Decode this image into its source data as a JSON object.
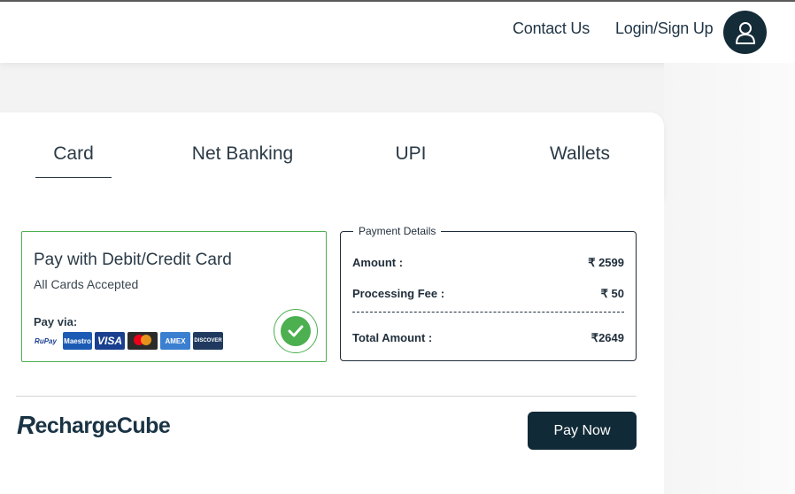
{
  "header": {
    "contact_label": "Contact Us",
    "login_label": "Login/Sign Up",
    "avatar_icon": "user-icon"
  },
  "tabs": [
    {
      "label": "Card",
      "active": true
    },
    {
      "label": "Net Banking",
      "active": false
    },
    {
      "label": "UPI",
      "active": false
    },
    {
      "label": "Wallets",
      "active": false
    }
  ],
  "card_option": {
    "title": "Pay with Debit/Credit Card",
    "subtitle": "All Cards Accepted",
    "pay_via_label": "Pay via:",
    "selected": true,
    "logos": [
      "RuPay",
      "Maestro",
      "VISA",
      "mastercard",
      "AMEX",
      "DISCOVER"
    ]
  },
  "payment_details": {
    "legend": "Payment Details",
    "amount_label": "Amount :",
    "amount_value": "₹ 2599",
    "fee_label": "Processing Fee :",
    "fee_value": "₹ 50",
    "total_label": "Total Amount :",
    "total_value": "₹2649"
  },
  "footer": {
    "brand_initial": "R",
    "brand_rest": "echargeCube",
    "pay_button_label": "Pay Now"
  },
  "colors": {
    "primary": "#102a37",
    "success": "#4caf50",
    "text": "#1f2d3a"
  }
}
